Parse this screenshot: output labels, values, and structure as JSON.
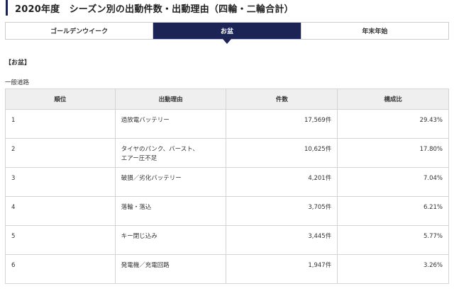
{
  "page_title": "2020年度　シーズン別の出動件数・出動理由（四輪・二輪合計）",
  "tabs": [
    {
      "label": "ゴールデンウイーク",
      "active": false
    },
    {
      "label": "お盆",
      "active": true
    },
    {
      "label": "年末年始",
      "active": false
    }
  ],
  "section_label": "【お盆】",
  "road_type": "一般道路",
  "table": {
    "headers": [
      "順位",
      "出動理由",
      "件数",
      "構成比"
    ],
    "rows": [
      {
        "rank": "1",
        "reason": [
          "過放電バッテリー"
        ],
        "count": "17,569件",
        "ratio": "29.43%"
      },
      {
        "rank": "2",
        "reason": [
          "タイヤのパンク、バースト、",
          "エアー圧不足"
        ],
        "count": "10,625件",
        "ratio": "17.80%"
      },
      {
        "rank": "3",
        "reason": [
          "破損／劣化バッテリー"
        ],
        "count": "4,201件",
        "ratio": "7.04%"
      },
      {
        "rank": "4",
        "reason": [
          "落輪・落込"
        ],
        "count": "3,705件",
        "ratio": "6.21%"
      },
      {
        "rank": "5",
        "reason": [
          "キー閉じ込み"
        ],
        "count": "3,445件",
        "ratio": "5.77%"
      },
      {
        "rank": "6",
        "reason": [
          "発電機／充電回路"
        ],
        "count": "1,947件",
        "ratio": "3.26%"
      }
    ]
  },
  "colors": {
    "accent": "#1b2454",
    "header_bg": "#efefef",
    "border": "#d4d4d4"
  }
}
